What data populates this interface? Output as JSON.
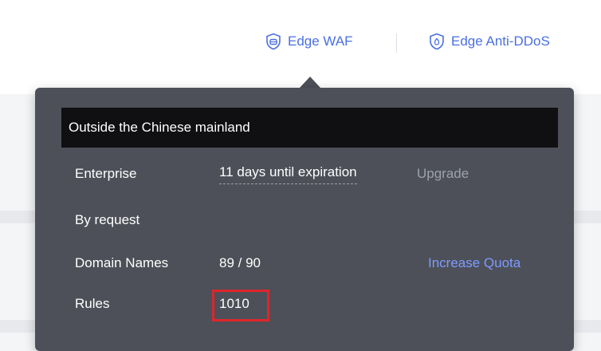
{
  "header": {
    "nav": [
      {
        "label": "Edge WAF",
        "icon": "shield-icon"
      },
      {
        "label": "Edge Anti-DDoS",
        "icon": "shield-icon"
      }
    ]
  },
  "popover": {
    "region": "Outside the Chinese mainland",
    "rows": {
      "edition": {
        "key": "Enterprise",
        "value": "11 days until expiration",
        "action": "Upgrade"
      },
      "billing": {
        "key": "By request"
      },
      "domains": {
        "key": "Domain Names",
        "value": "89 / 90",
        "action": "Increase Quota"
      },
      "rules": {
        "key": "Rules",
        "value": "1010"
      }
    }
  },
  "colors": {
    "accent": "#4a6fe1",
    "popover_bg": "#4d5058",
    "header_bg": "#101012",
    "link": "#7e9bff",
    "highlight": "#e0252b"
  }
}
